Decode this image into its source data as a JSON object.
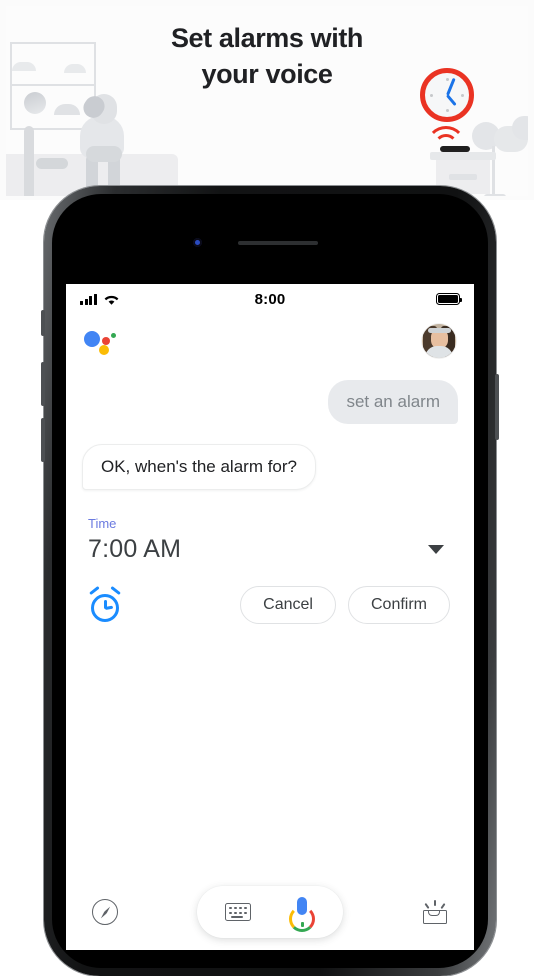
{
  "promo": {
    "title_line1": "Set alarms with",
    "title_line2": "your voice",
    "clock_icon": "alarm-clock-illustration",
    "sound_waves_icon": "sound-wave-illustration",
    "accent_red": "#ea3323",
    "accent_blue": "#1a73e8",
    "background": "#fcfcfc"
  },
  "phone": {
    "camera_icon": "front-camera",
    "speaker_icon": "earpiece-speaker"
  },
  "statusbar": {
    "signal_icon": "cellular-signal-icon",
    "wifi_icon": "wifi-icon",
    "time": "8:00",
    "battery_icon": "battery-full-icon"
  },
  "assistant_header": {
    "logo_icon": "google-assistant-logo",
    "avatar_icon": "user-avatar"
  },
  "chat": {
    "user_message": "set an alarm",
    "assistant_message": "OK, when's the alarm for?"
  },
  "alarm_card": {
    "field_label": "Time",
    "field_value": "7:00 AM",
    "dropdown_icon": "chevron-down-icon",
    "alarm_icon": "alarm-clock-icon",
    "cancel_label": "Cancel",
    "confirm_label": "Confirm",
    "label_color": "#6b7ae0",
    "icon_color": "#1a8cff"
  },
  "bottom_nav": {
    "explore_icon": "compass-explore-icon",
    "keyboard_icon": "keyboard-icon",
    "mic_icon": "google-microphone-icon",
    "updates_icon": "updates-inbox-icon"
  }
}
